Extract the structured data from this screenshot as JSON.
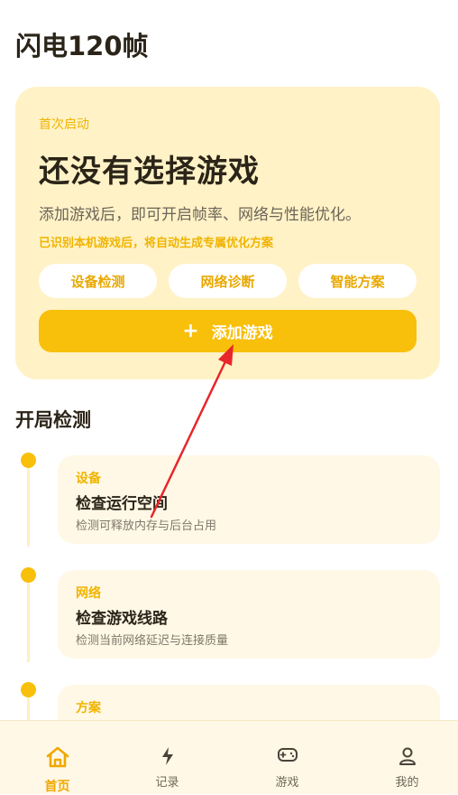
{
  "app": {
    "title": "闪电120帧"
  },
  "hero": {
    "eyebrow": "首次启动",
    "headline": "还没有选择游戏",
    "description": "添加游戏后，即可开启帧率、网络与性能优化。",
    "note": "已识别本机游戏后，将自动生成专属优化方案",
    "chips": [
      "设备检测",
      "网络诊断",
      "智能方案"
    ],
    "add_button": {
      "icon": "plus-icon",
      "label": "添加游戏"
    }
  },
  "checks": {
    "title": "开局检测",
    "items": [
      {
        "category": "设备",
        "title": "检查运行空间",
        "subtitle": "检测可释放内存与后台占用"
      },
      {
        "category": "网络",
        "title": "检查游戏线路",
        "subtitle": "检测当前网络延迟与连接质量"
      },
      {
        "category": "方案",
        "title": "",
        "subtitle": ""
      }
    ]
  },
  "tabbar": {
    "tabs": [
      {
        "label": "首页",
        "icon": "home-icon",
        "active": true
      },
      {
        "label": "记录",
        "icon": "lightning-icon",
        "active": false
      },
      {
        "label": "游戏",
        "icon": "gamepad-icon",
        "active": false
      },
      {
        "label": "我的",
        "icon": "user-icon",
        "active": false
      }
    ]
  },
  "colors": {
    "accent": "#f8bf0b",
    "card": "#fff2c6",
    "annotation_arrow": "#e8262a"
  }
}
